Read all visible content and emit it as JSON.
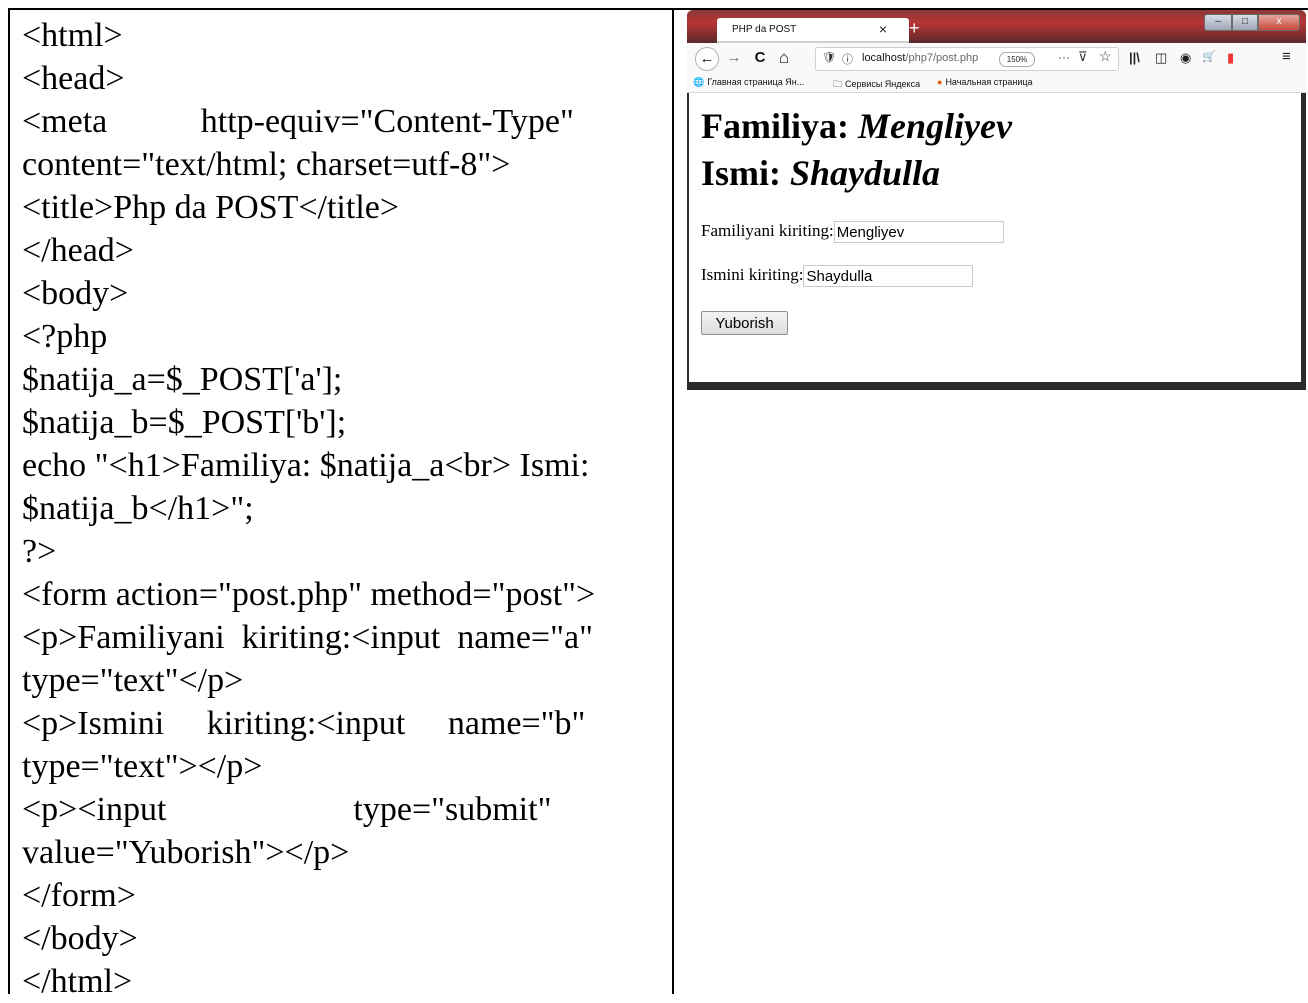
{
  "code_lines": [
    "<html>",
    "<head>",
    "<meta           http-equiv=\"Content-Type\"",
    "content=\"text/html; charset=utf-8\">",
    "<title>Php da POST</title>",
    "</head>",
    "<body>",
    "<?php",
    "$natija_a=$_POST['a'];",
    "$natija_b=$_POST['b'];",
    "echo \"<h1>Familiya: $natija_a<br> Ismi:",
    "$natija_b</h1>\";",
    "?>",
    "<form action=\"post.php\" method=\"post\">",
    "<p>Familiyani  kiriting:<input  name=\"a\"",
    "type=\"text\"</p>",
    "<p>Ismini     kiriting:<input     name=\"b\"",
    "type=\"text\"></p>",
    "<p><input                      type=\"submit\"",
    "value=\"Yuborish\"></p>",
    "</form>",
    "</body>",
    "</html>"
  ],
  "browser": {
    "tab_title": "PHP da POST",
    "tab_close": "×",
    "new_tab": "+",
    "window_controls": {
      "min": "–",
      "max": "□",
      "close": "x"
    },
    "nav": {
      "back": "←",
      "forward": "→",
      "reload": "C",
      "home": "⌂"
    },
    "url": {
      "host": "localhost",
      "path": "/php7/post.php",
      "zoom": "150%"
    },
    "url_actions": {
      "more": "···",
      "pocket": "⊽",
      "star": "☆"
    },
    "toolbar": {
      "library": "||\\",
      "sidebar": "◫",
      "account": "◉",
      "cart": "🛒",
      "flag": "▮",
      "menu": "≡"
    },
    "bookmarks": [
      {
        "icon": "globe-icon",
        "glyph": "🌐",
        "label": "Главная страница Ян..."
      },
      {
        "icon": "folder-icon",
        "glyph": "🗀",
        "label": "Сервисы Яндекса"
      },
      {
        "icon": "firefox-icon",
        "glyph": "●",
        "label": "Начальная страница"
      }
    ]
  },
  "page": {
    "familiya_label": "Familiya:",
    "familiya_value": "Mengliyev",
    "ismi_label": "Ismi:",
    "ismi_value": "Shaydulla",
    "field_a_label": "Familiyani kiriting:",
    "field_a_value": "Mengliyev",
    "field_b_label": "Ismini kiriting:",
    "field_b_value": "Shaydulla",
    "submit_label": "Yuborish"
  }
}
